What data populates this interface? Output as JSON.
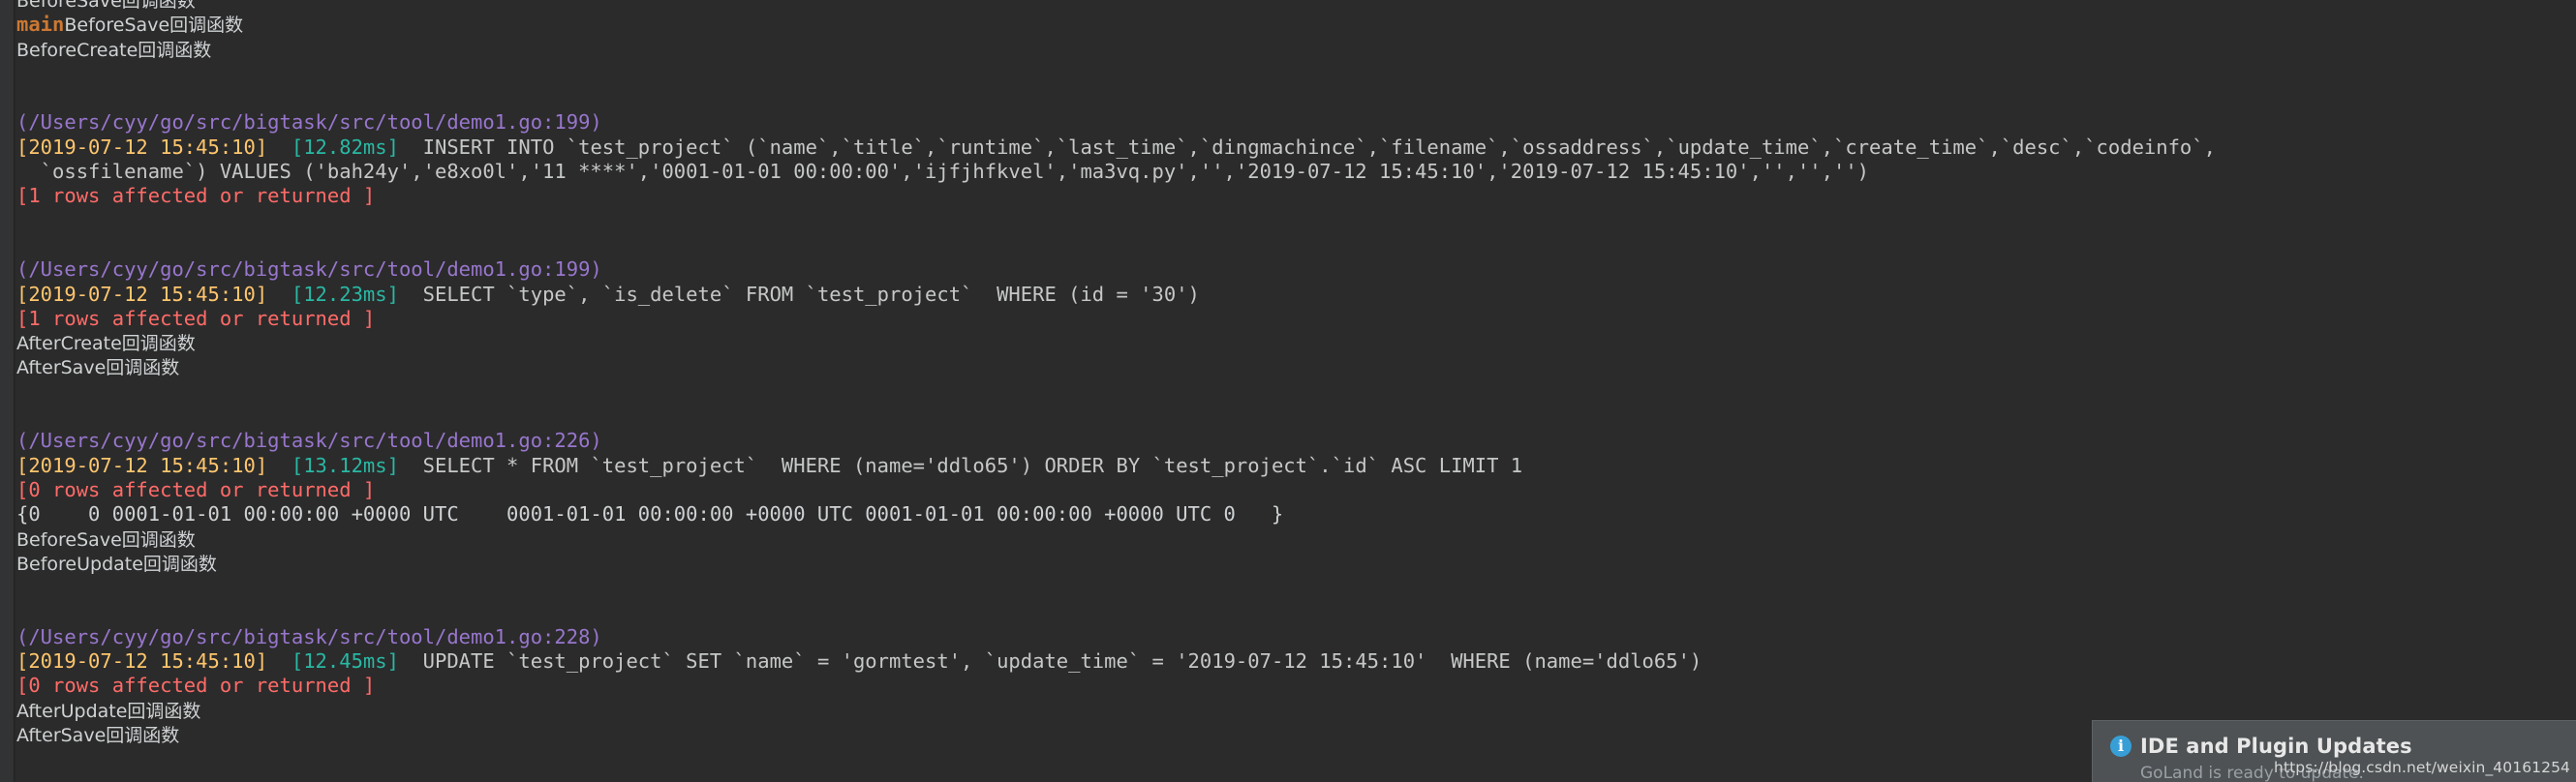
{
  "console": {
    "lines": [
      {
        "type": "cutoff",
        "segments": [
          {
            "cls": "c-plain cjk",
            "text": "BeforeSave回调函数"
          }
        ]
      },
      {
        "type": "mixed",
        "segments": [
          {
            "cls": "c-main",
            "text": "main"
          },
          {
            "cls": "c-plain cjk",
            "text": "BeforeSave回调函数"
          }
        ]
      },
      {
        "type": "plain",
        "segments": [
          {
            "cls": "c-plain cjk",
            "text": "BeforeCreate回调函数"
          }
        ]
      },
      {
        "type": "blank",
        "segments": []
      },
      {
        "type": "blank",
        "segments": []
      },
      {
        "type": "path",
        "segments": [
          {
            "cls": "c-path",
            "text": "(/Users/cyy/go/src/bigtask/src/tool/demo1.go:199)"
          }
        ]
      },
      {
        "type": "sql",
        "segments": [
          {
            "cls": "c-time",
            "text": "[2019-07-12 15:45:10]"
          },
          {
            "cls": "c-sql",
            "text": "  "
          },
          {
            "cls": "c-dur",
            "text": "[12.82ms]"
          },
          {
            "cls": "c-sql",
            "text": "  INSERT INTO `test_project` (`name`,`title`,`runtime`,`last_time`,`dingmachince`,`filename`,`ossaddress`,`update_time`,`create_time`,`desc`,`codeinfo`,"
          }
        ]
      },
      {
        "type": "sql",
        "segments": [
          {
            "cls": "c-sql",
            "text": "  `ossfilename`) VALUES ('bah24y','e8xo0l','11 ****','0001-01-01 00:00:00','ijfjhfkvel','ma3vq.py','','2019-07-12 15:45:10','2019-07-12 15:45:10','','','')"
          }
        ]
      },
      {
        "type": "rows",
        "segments": [
          {
            "cls": "c-rows",
            "text": "[1 rows affected or returned ]"
          }
        ]
      },
      {
        "type": "blank",
        "segments": []
      },
      {
        "type": "blank",
        "segments": []
      },
      {
        "type": "path",
        "segments": [
          {
            "cls": "c-path",
            "text": "(/Users/cyy/go/src/bigtask/src/tool/demo1.go:199)"
          }
        ]
      },
      {
        "type": "sql",
        "segments": [
          {
            "cls": "c-time",
            "text": "[2019-07-12 15:45:10]"
          },
          {
            "cls": "c-sql",
            "text": "  "
          },
          {
            "cls": "c-dur",
            "text": "[12.23ms]"
          },
          {
            "cls": "c-sql",
            "text": "  SELECT `type`, `is_delete` FROM `test_project`  WHERE (id = '30')"
          }
        ]
      },
      {
        "type": "rows",
        "segments": [
          {
            "cls": "c-rows",
            "text": "[1 rows affected or returned ]"
          }
        ]
      },
      {
        "type": "plain",
        "segments": [
          {
            "cls": "c-plain cjk",
            "text": "AfterCreate回调函数"
          }
        ]
      },
      {
        "type": "plain",
        "segments": [
          {
            "cls": "c-plain cjk",
            "text": "AfterSave回调函数"
          }
        ]
      },
      {
        "type": "blank",
        "segments": []
      },
      {
        "type": "blank",
        "segments": []
      },
      {
        "type": "path",
        "segments": [
          {
            "cls": "c-path",
            "text": "(/Users/cyy/go/src/bigtask/src/tool/demo1.go:226)"
          }
        ]
      },
      {
        "type": "sql",
        "segments": [
          {
            "cls": "c-time",
            "text": "[2019-07-12 15:45:10]"
          },
          {
            "cls": "c-sql",
            "text": "  "
          },
          {
            "cls": "c-dur",
            "text": "[13.12ms]"
          },
          {
            "cls": "c-sql",
            "text": "  SELECT * FROM `test_project`  WHERE (name='ddlo65') ORDER BY `test_project`.`id` ASC LIMIT 1"
          }
        ]
      },
      {
        "type": "rows",
        "segments": [
          {
            "cls": "c-rows",
            "text": "[0 rows affected or returned ]"
          }
        ]
      },
      {
        "type": "struct",
        "segments": [
          {
            "cls": "c-struct",
            "text": "{0    0 0001-01-01 00:00:00 +0000 UTC    0001-01-01 00:00:00 +0000 UTC 0001-01-01 00:00:00 +0000 UTC 0   }"
          }
        ]
      },
      {
        "type": "plain",
        "segments": [
          {
            "cls": "c-plain cjk",
            "text": "BeforeSave回调函数"
          }
        ]
      },
      {
        "type": "plain",
        "segments": [
          {
            "cls": "c-plain cjk",
            "text": "BeforeUpdate回调函数"
          }
        ]
      },
      {
        "type": "blank",
        "segments": []
      },
      {
        "type": "blank",
        "segments": []
      },
      {
        "type": "path",
        "segments": [
          {
            "cls": "c-path",
            "text": "(/Users/cyy/go/src/bigtask/src/tool/demo1.go:228)"
          }
        ]
      },
      {
        "type": "sql",
        "segments": [
          {
            "cls": "c-time",
            "text": "[2019-07-12 15:45:10]"
          },
          {
            "cls": "c-sql",
            "text": "  "
          },
          {
            "cls": "c-dur",
            "text": "[12.45ms]"
          },
          {
            "cls": "c-sql",
            "text": "  UPDATE `test_project` SET `name` = 'gormtest', `update_time` = '2019-07-12 15:45:10'  WHERE (name='ddlo65')"
          }
        ]
      },
      {
        "type": "rows",
        "segments": [
          {
            "cls": "c-rows",
            "text": "[0 rows affected or returned ]"
          }
        ]
      },
      {
        "type": "plain",
        "segments": [
          {
            "cls": "c-plain cjk",
            "text": "AfterUpdate回调函数"
          }
        ]
      },
      {
        "type": "plain",
        "segments": [
          {
            "cls": "c-plain cjk",
            "text": "AfterSave回调函数"
          }
        ]
      }
    ]
  },
  "notification": {
    "icon": "info-icon",
    "title": "IDE and Plugin Updates",
    "subtitle": "GoLand is ready to update."
  },
  "watermark": {
    "text": "https://blog.csdn.net/weixin_40161254"
  },
  "colors": {
    "background": "#2b2b2b",
    "gutter": "#313335",
    "path": "#9876cd",
    "timestamp": "#ffc66d",
    "duration": "#29b8a4",
    "sql": "#c5c8c6",
    "rows_affected": "#ff6b68",
    "plain_text": "#cfd2d4",
    "main_prefix": "#cc7832",
    "notification_background": "#4e5254",
    "info_icon": "#389fd6"
  }
}
